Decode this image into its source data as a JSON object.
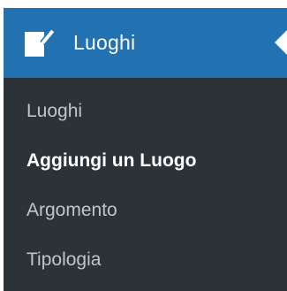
{
  "menu": {
    "title": "Luoghi",
    "icon": "edit-post-icon",
    "colors": {
      "header_bg": "#2271b1",
      "menu_bg": "#2c3338",
      "item_text": "#c3c4c7",
      "current_text": "#ffffff"
    },
    "items": [
      {
        "label": "Luoghi",
        "current": false
      },
      {
        "label": "Aggiungi un Luogo",
        "current": true
      },
      {
        "label": "Argomento",
        "current": false
      },
      {
        "label": "Tipologia",
        "current": false
      }
    ]
  }
}
